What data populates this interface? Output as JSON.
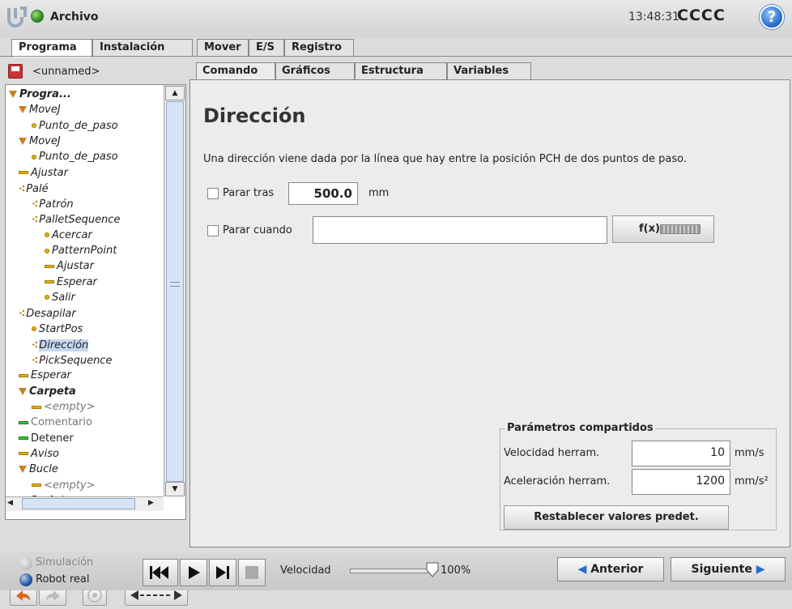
{
  "app": {
    "title": "Archivo",
    "time": "13:48:31",
    "robot_name": "CCCC",
    "help_icon": "?"
  },
  "main_tabs": [
    "Programa",
    "Instalación",
    "Mover",
    "E/S",
    "Registro"
  ],
  "left": {
    "file_name": "<unnamed>",
    "tree": [
      {
        "label": "Progra...",
        "icon": "triangle",
        "bold": true
      },
      {
        "label": "MoveJ",
        "icon": "triangle"
      },
      {
        "label": "Punto_de_paso",
        "icon": "waypoint"
      },
      {
        "label": "MoveJ",
        "icon": "triangle"
      },
      {
        "label": "Punto_de_paso",
        "icon": "waypoint"
      },
      {
        "label": "Ajustar",
        "icon": "bar"
      },
      {
        "label": "Palé",
        "icon": "dots"
      },
      {
        "label": "Patrón",
        "icon": "dots"
      },
      {
        "label": "PalletSequence",
        "icon": "dots"
      },
      {
        "label": "Acercar",
        "icon": "waypoint"
      },
      {
        "label": "PatternPoint",
        "icon": "waypoint"
      },
      {
        "label": "Ajustar",
        "icon": "bar"
      },
      {
        "label": "Esperar",
        "icon": "bar"
      },
      {
        "label": "Salir",
        "icon": "waypoint"
      },
      {
        "label": "Desapilar",
        "icon": "dots"
      },
      {
        "label": "StartPos",
        "icon": "waypoint"
      },
      {
        "label": "Dirección",
        "icon": "dots",
        "selected": true
      },
      {
        "label": "PickSequence",
        "icon": "dots"
      },
      {
        "label": "Esperar",
        "icon": "bar"
      },
      {
        "label": "Carpeta",
        "icon": "triangle",
        "bold": true
      },
      {
        "label": "<empty>",
        "icon": "bar",
        "gray": true
      },
      {
        "label": "Comentario",
        "icon": "bar-green",
        "gray": true,
        "normal": true
      },
      {
        "label": "Detener",
        "icon": "bar-green",
        "normal": true
      },
      {
        "label": "Aviso",
        "icon": "bar"
      },
      {
        "label": "Bucle",
        "icon": "triangle"
      },
      {
        "label": "<empty>",
        "icon": "bar",
        "gray": true
      },
      {
        "label": "Script",
        "icon": "script",
        "bold": true
      }
    ]
  },
  "content_tabs": [
    "Comando",
    "Gráficos",
    "Estructura",
    "Variables"
  ],
  "command": {
    "heading": "Dirección",
    "description": "Una dirección viene dada por la línea que hay entre la posición PCH de dos puntos de paso.",
    "stop_after_label": "Parar tras",
    "stop_after_value": "500.0",
    "stop_after_unit": "mm",
    "stop_when_label": "Parar cuando",
    "stop_when_value": "",
    "fx_label": "f(x)"
  },
  "shared": {
    "title": "Parámetros compartidos",
    "speed_label": "Velocidad herram.",
    "speed_value": "10",
    "speed_unit": "mm/s",
    "accel_label": "Aceleración herram.",
    "accel_value": "1200",
    "accel_unit": "mm/s²",
    "reset_label": "Restablecer valores predet."
  },
  "footer": {
    "sim_label": "Simulación",
    "real_label": "Robot real",
    "speed_label": "Velocidad",
    "speed_value": "100%",
    "speed_fraction": 1.0,
    "prev_label": "Anterior",
    "next_label": "Siguiente"
  },
  "colors": {
    "accent": "#2a6cc8",
    "selection": "#c4d7ef",
    "node_icon": "#e3b000"
  }
}
